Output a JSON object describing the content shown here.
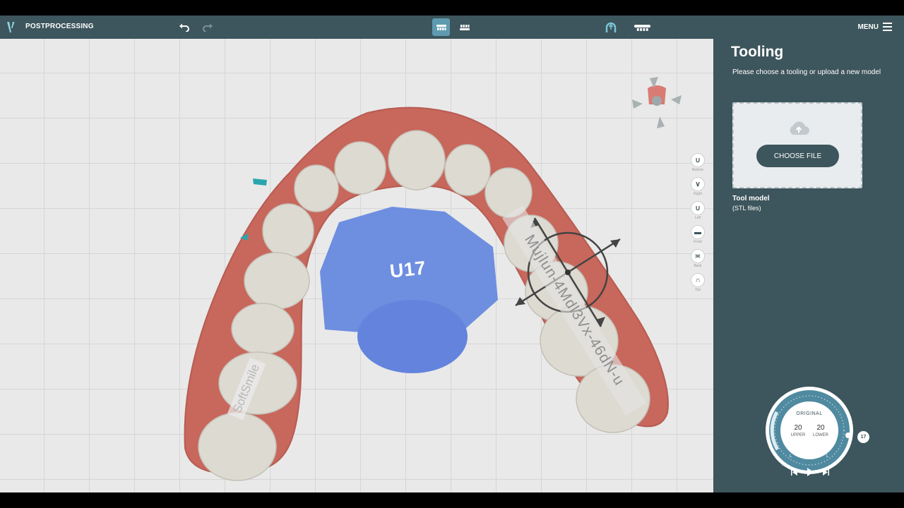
{
  "app": {
    "title": "POSTPROCESSING",
    "menu_label": "MENU"
  },
  "toolbar": {
    "icons": [
      "undo-icon",
      "redo-icon",
      "upper-jaw-view-icon",
      "lower-jaw-view-icon",
      "arch-icon",
      "aligner-icon",
      "hamburger-icon"
    ],
    "active_tool": "upper-jaw-view"
  },
  "viewport": {
    "model_label": "U17",
    "engraving_left": "SoftSmile",
    "engraving_right": "Mujlun-4Mdl3Vx-46dN-u",
    "colors": {
      "gingiva": "#c8675c",
      "teeth": "#dddad2",
      "tooling": "#6e8ee0",
      "attachments": "#2aa6ad"
    }
  },
  "view_buttons": [
    {
      "glyph": "∪",
      "label": "Bottom"
    },
    {
      "glyph": "∨",
      "label": "Right"
    },
    {
      "glyph": "∪",
      "label": "Left"
    },
    {
      "glyph": "▬",
      "label": "Front"
    },
    {
      "glyph": "≍",
      "label": "Back"
    },
    {
      "glyph": "∩",
      "label": "Top"
    }
  ],
  "panel": {
    "title": "Tooling",
    "subtitle": "Please choose a tooling or upload a new model",
    "choose_file": "CHOOSE FILE",
    "tool_model_title": "Tool model",
    "tool_model_sub": "(STL files)"
  },
  "dial": {
    "mode": "ORIGINAL",
    "upper": {
      "value": "20",
      "label": "UPPER"
    },
    "lower": {
      "value": "20",
      "label": "LOWER"
    },
    "step_badge": "17",
    "tick_labels": [
      "U",
      "L",
      "L",
      "U"
    ]
  },
  "playback": {
    "icons": [
      "skip-back-icon",
      "play-icon",
      "skip-forward-icon"
    ]
  }
}
